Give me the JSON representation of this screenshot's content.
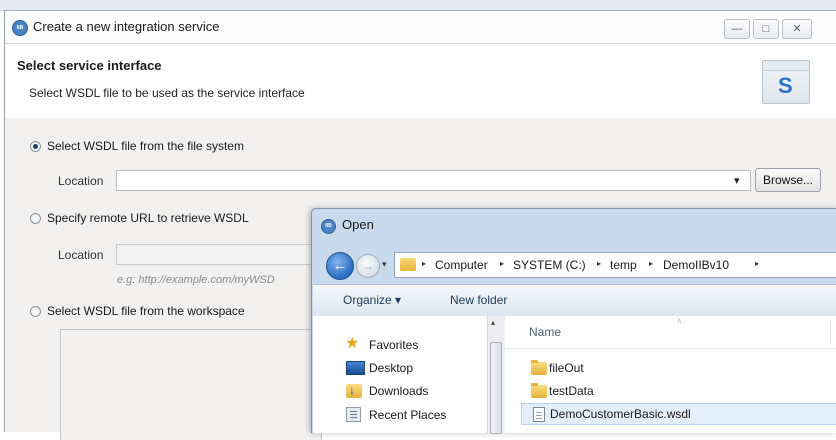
{
  "wizard": {
    "title": "Create a new integration service",
    "title_icon_glyph": "IIB",
    "window_controls": {
      "minimize": "—",
      "maximize": "□",
      "close": "✕"
    },
    "header": {
      "title": "Select service interface",
      "subtitle": "Select WSDL file to be used as the service interface",
      "logo_letter": "S"
    },
    "options": {
      "file_system": {
        "label": "Select WSDL file from the file system",
        "selected": true,
        "location_label": "Location",
        "location_value": "",
        "browse_label": "Browse...",
        "dropdown_glyph": "▾"
      },
      "remote_url": {
        "label": "Specify remote URL to retrieve WSDL",
        "selected": false,
        "location_label": "Location",
        "location_value": "",
        "hint": "e.g: http://example.com/myWSD"
      },
      "workspace": {
        "label": "Select WSDL file from the workspace",
        "selected": false
      }
    }
  },
  "open_dialog": {
    "title": "Open",
    "title_icon_glyph": "IIB",
    "back_glyph": "←",
    "forward_glyph": "→",
    "history_glyph": "▾",
    "breadcrumb": [
      "Computer",
      "SYSTEM (C:)",
      "temp",
      "DemoIIBv10"
    ],
    "breadcrumb_separator": "▸",
    "toolbar": {
      "organize": "Organize ▾",
      "new_folder": "New folder"
    },
    "columns": {
      "name": "Name",
      "sort_glyph": "˄"
    },
    "nav_items": [
      {
        "label": "Favorites",
        "icon": "star-icon"
      },
      {
        "label": "Desktop",
        "icon": "desktop-icon"
      },
      {
        "label": "Downloads",
        "icon": "downloads-icon"
      },
      {
        "label": "Recent Places",
        "icon": "recent-places-icon"
      }
    ],
    "files": [
      {
        "name": "fileOut",
        "type": "folder"
      },
      {
        "name": "testData",
        "type": "folder"
      },
      {
        "name": "DemoCustomerBasic.wsdl",
        "type": "file",
        "selected": true
      }
    ],
    "scroll_up_glyph": "▴"
  }
}
